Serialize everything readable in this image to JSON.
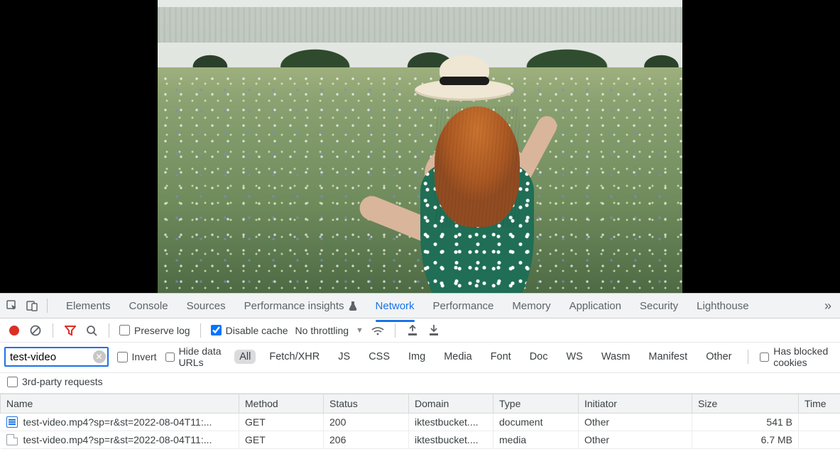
{
  "tabs": {
    "elements": "Elements",
    "console": "Console",
    "sources": "Sources",
    "perf_insights": "Performance insights",
    "network": "Network",
    "performance": "Performance",
    "memory": "Memory",
    "application": "Application",
    "security": "Security",
    "lighthouse": "Lighthouse",
    "active": "network"
  },
  "toolbar": {
    "preserve_log": "Preserve log",
    "preserve_log_checked": false,
    "disable_cache": "Disable cache",
    "disable_cache_checked": true,
    "throttling": "No throttling"
  },
  "filter": {
    "value": "test-video",
    "invert": "Invert",
    "invert_checked": false,
    "hide_data_urls": "Hide data URLs",
    "hide_data_urls_checked": false,
    "types": [
      "All",
      "Fetch/XHR",
      "JS",
      "CSS",
      "Img",
      "Media",
      "Font",
      "Doc",
      "WS",
      "Wasm",
      "Manifest",
      "Other"
    ],
    "type_active": "All",
    "has_blocked": "Has blocked cookies",
    "has_blocked_checked": false,
    "third_party": "3rd-party requests",
    "third_party_checked": false
  },
  "table": {
    "columns": {
      "name": "Name",
      "method": "Method",
      "status": "Status",
      "domain": "Domain",
      "type": "Type",
      "initiator": "Initiator",
      "size": "Size",
      "time": "Time"
    },
    "rows": [
      {
        "icon": "doc",
        "name": "test-video.mp4?sp=r&st=2022-08-04T11:...",
        "method": "GET",
        "status": "200",
        "domain": "iktestbucket....",
        "type": "document",
        "initiator": "Other",
        "size": "541 B"
      },
      {
        "icon": "file",
        "name": "test-video.mp4?sp=r&st=2022-08-04T11:...",
        "method": "GET",
        "status": "206",
        "domain": "iktestbucket....",
        "type": "media",
        "initiator": "Other",
        "size": "6.7 MB"
      }
    ]
  }
}
